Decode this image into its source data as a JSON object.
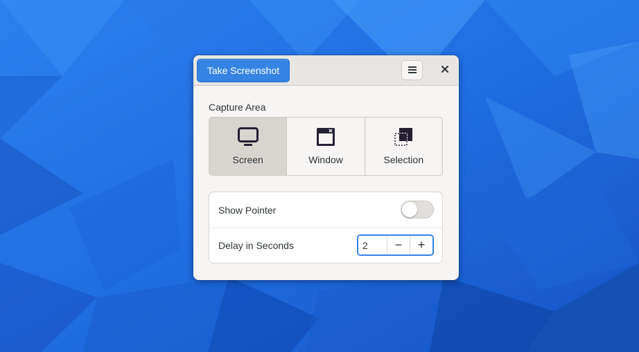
{
  "header": {
    "take_screenshot_label": "Take Screenshot",
    "menu_icon": "hamburger-menu-icon",
    "close_icon": "close-icon"
  },
  "capture_area": {
    "label": "Capture Area",
    "options": [
      {
        "label": "Screen",
        "icon": "monitor-icon",
        "selected": true
      },
      {
        "label": "Window",
        "icon": "window-icon",
        "selected": false
      },
      {
        "label": "Selection",
        "icon": "selection-icon",
        "selected": false
      }
    ]
  },
  "settings": {
    "show_pointer_label": "Show Pointer",
    "show_pointer_on": false,
    "delay_label": "Delay in Seconds",
    "delay_value": "2",
    "decrement_label": "−",
    "increment_label": "+"
  },
  "colors": {
    "accent": "#3584e4",
    "wallpaper": "#1f6fe0"
  }
}
